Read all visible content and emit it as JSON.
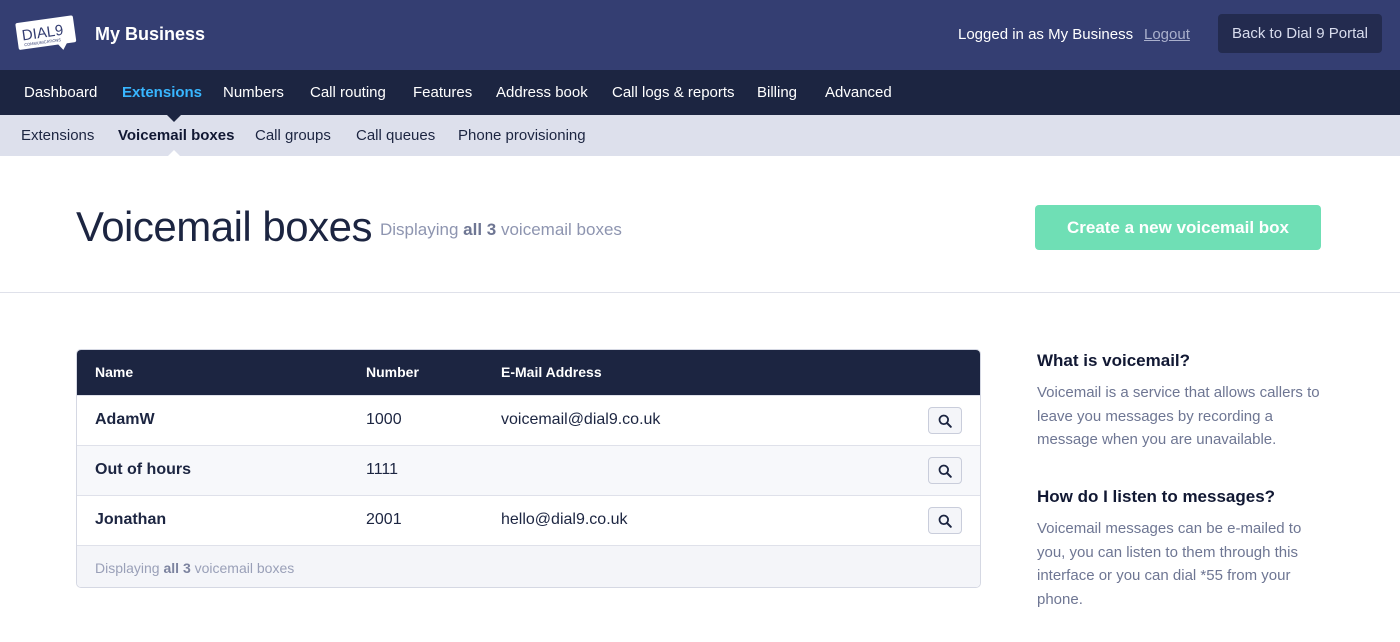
{
  "header": {
    "logo_text": "DIAL9",
    "logo_subtext": "COMMUNICATIONS",
    "business_name": "My Business",
    "logged_in_text": "Logged in as My Business",
    "logout_label": "Logout",
    "portal_button_label": "Back to Dial 9 Portal"
  },
  "main_nav": {
    "items": [
      {
        "label": "Dashboard"
      },
      {
        "label": "Extensions",
        "active": true
      },
      {
        "label": "Numbers"
      },
      {
        "label": "Call routing"
      },
      {
        "label": "Features"
      },
      {
        "label": "Address book"
      },
      {
        "label": "Call logs & reports"
      },
      {
        "label": "Billing"
      },
      {
        "label": "Advanced"
      }
    ]
  },
  "sub_nav": {
    "items": [
      {
        "label": "Extensions"
      },
      {
        "label": "Voicemail boxes",
        "active": true
      },
      {
        "label": "Call groups"
      },
      {
        "label": "Call queues"
      },
      {
        "label": "Phone provisioning"
      }
    ]
  },
  "page": {
    "title": "Voicemail boxes",
    "subtitle_prefix": "Displaying ",
    "subtitle_bold": "all 3",
    "subtitle_suffix": " voicemail boxes",
    "create_button_label": "Create a new voicemail box"
  },
  "table": {
    "columns": [
      "Name",
      "Number",
      "E-Mail Address"
    ],
    "rows": [
      {
        "name": "AdamW",
        "number": "1000",
        "email": "voicemail@dial9.co.uk"
      },
      {
        "name": "Out of hours",
        "number": "1111",
        "email": ""
      },
      {
        "name": "Jonathan",
        "number": "2001",
        "email": "hello@dial9.co.uk"
      }
    ],
    "footer_prefix": "Displaying ",
    "footer_bold": "all 3",
    "footer_suffix": " voicemail boxes"
  },
  "sidebar": {
    "sections": [
      {
        "heading": "What is voicemail?",
        "body": "Voicemail is a service that allows callers to leave you messages by recording a message when you are unavailable."
      },
      {
        "heading": "How do I listen to messages?",
        "body": "Voicemail messages can be e-mailed to you, you can listen to them through this interface or you can dial *55 from your phone."
      }
    ]
  },
  "icons": {
    "view": "search-icon"
  },
  "colors": {
    "topbar": "#343e72",
    "nav": "#1c2541",
    "active_nav": "#38b6ff",
    "subnav": "#dde0ec",
    "create_button": "#6fdfb5"
  }
}
